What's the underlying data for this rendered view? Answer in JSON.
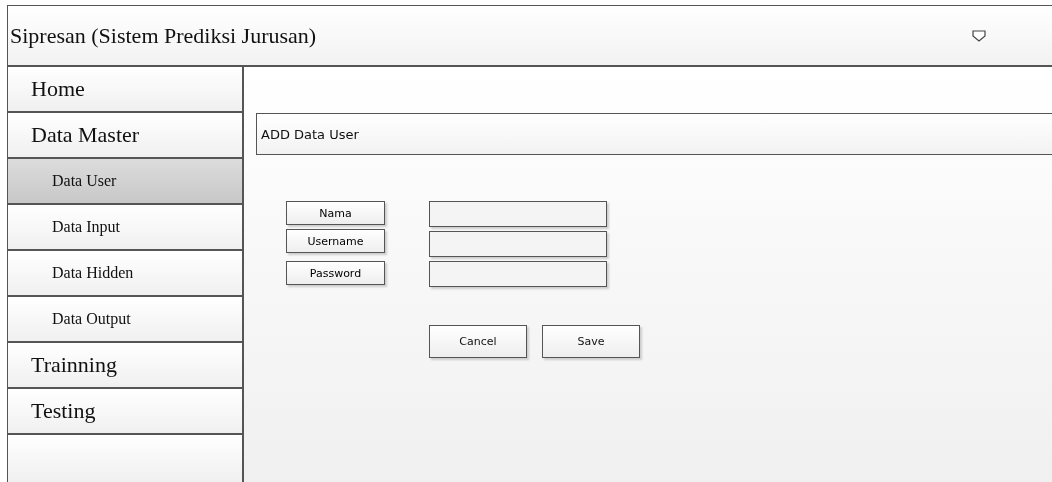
{
  "header": {
    "title": "Sipresan (Sistem Prediksi Jurusan)"
  },
  "sidebar": {
    "items": [
      {
        "label": "Home",
        "kind": "section",
        "selected": false
      },
      {
        "label": "Data Master",
        "kind": "section",
        "selected": false
      },
      {
        "label": "Data User",
        "kind": "sub",
        "selected": true
      },
      {
        "label": "Data Input",
        "kind": "sub",
        "selected": false
      },
      {
        "label": "Data Hidden",
        "kind": "sub",
        "selected": false
      },
      {
        "label": "Data Output",
        "kind": "sub",
        "selected": false
      },
      {
        "label": "Trainning",
        "kind": "section",
        "selected": false
      },
      {
        "label": "Testing",
        "kind": "section",
        "selected": false
      }
    ]
  },
  "panel": {
    "title": "ADD Data User"
  },
  "form": {
    "fields": [
      {
        "label": "Nama"
      },
      {
        "label": "Username"
      },
      {
        "label": "Password"
      }
    ],
    "buttons": [
      "Cancel",
      "Save"
    ]
  }
}
